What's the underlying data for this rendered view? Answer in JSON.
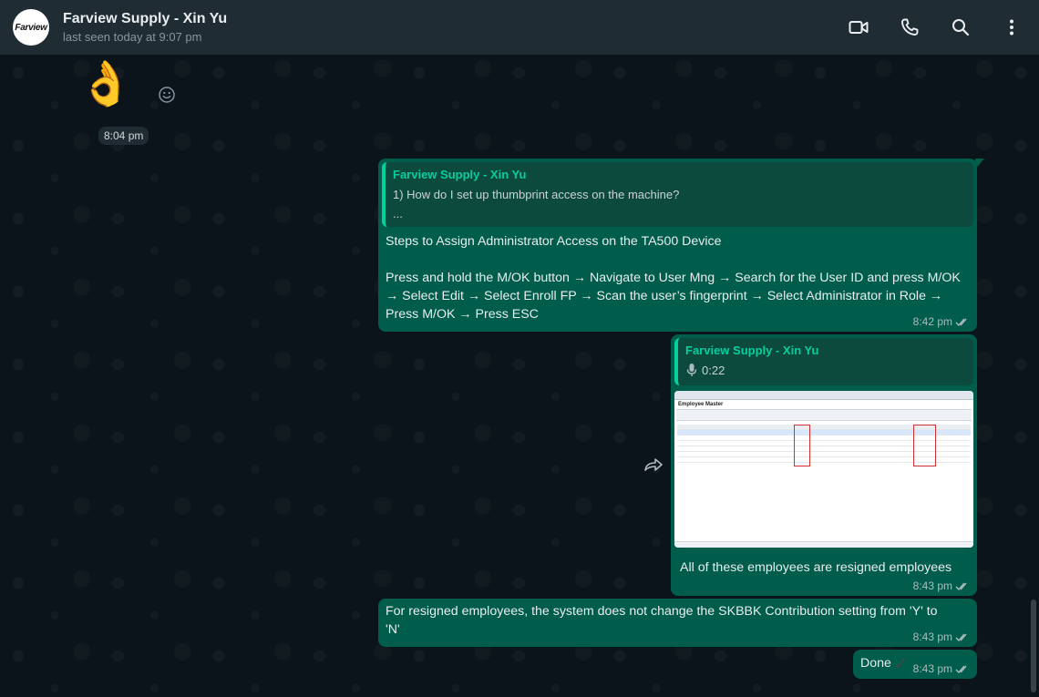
{
  "header": {
    "avatar_text": "Farview",
    "name": "Farview Supply - Xin Yu",
    "status": "last seen today at 9:07 pm",
    "icons": [
      "video-call-icon",
      "voice-call-icon",
      "search-icon",
      "menu-icon"
    ]
  },
  "chat": {
    "emoji_message": "👌",
    "emoji_time": "8:04 pm",
    "bubble1": {
      "quote_author": "Farview Supply - Xin Yu",
      "quote_line1": "1) How do I set up thumbprint access on the machine?",
      "quote_line2": "...",
      "text": "Steps to Assign Administrator Access on the TA500 Device\n\nPress and hold the M/OK button → Navigate to User Mng → Search for the User ID and press M/OK → Select Edit → Select Enroll FP → Scan the user’s fingerprint → Select Administrator in Role → Press M/OK → Press ESC",
      "time": "8:42 pm"
    },
    "bubble2": {
      "quote_author": "Farview Supply - Xin Yu",
      "voice_duration": "0:22",
      "image_heading": "Employee Master",
      "text": "All of these employees are resigned employees",
      "time": "8:43 pm"
    },
    "bubble3": {
      "text": "For resigned employees, the system does not change the SKBBK Contribution setting from 'Y' to 'N'",
      "time": "8:43 pm"
    },
    "bubble4": {
      "text": "Done",
      "time": "8:43 pm"
    }
  },
  "colors": {
    "header_bg": "#202c33",
    "chat_bg": "#0b141a",
    "outgoing_bubble": "#005c4b",
    "quote_accent": "#06cf9c",
    "meta_text": "#aebac1"
  }
}
